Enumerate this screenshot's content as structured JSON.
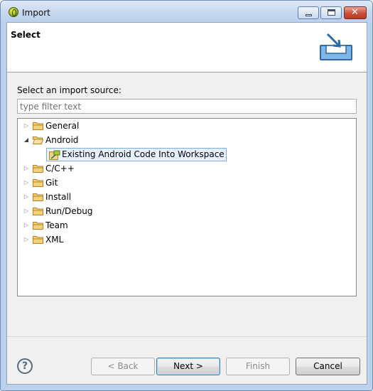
{
  "window": {
    "title": "Import"
  },
  "header": {
    "title": "Select",
    "icon": "import-wizard-icon"
  },
  "main": {
    "source_label": "Select an import source:",
    "filter_placeholder": "type filter text",
    "filter_value": "",
    "tree": [
      {
        "label": "General",
        "expanded": false
      },
      {
        "label": "Android",
        "expanded": true,
        "children": [
          {
            "label": "Existing Android Code Into Workspace",
            "selected": true
          }
        ]
      },
      {
        "label": "C/C++",
        "expanded": false
      },
      {
        "label": "Git",
        "expanded": false
      },
      {
        "label": "Install",
        "expanded": false
      },
      {
        "label": "Run/Debug",
        "expanded": false
      },
      {
        "label": "Team",
        "expanded": false
      },
      {
        "label": "XML",
        "expanded": false
      }
    ]
  },
  "footer": {
    "help_icon": "help-icon",
    "back_label": "< Back",
    "next_label": "Next >",
    "finish_label": "Finish",
    "cancel_label": "Cancel"
  },
  "colors": {
    "titlebar": "#c6d8ef",
    "selection": "#e8f2fc",
    "selection_border": "#84acdd",
    "folder": "#e9c15a"
  }
}
